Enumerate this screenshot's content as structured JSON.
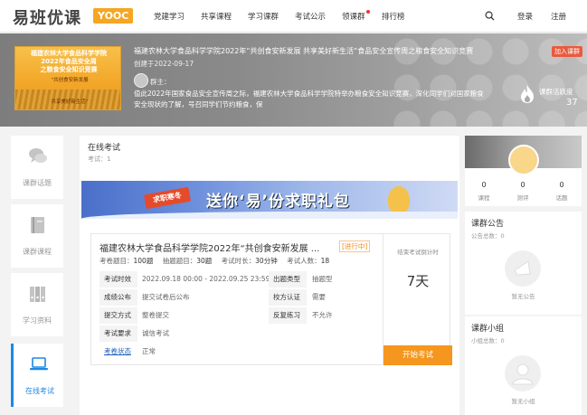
{
  "header": {
    "logo_text": "易班优课",
    "logo_badge": "YOOC",
    "nav": [
      "党建学习",
      "共享课程",
      "学习课群",
      "考试公示",
      "领课群",
      "排行榜"
    ],
    "login": "登录",
    "register": "注册"
  },
  "hero": {
    "cover_line1": "福建农林大学食品科学学院",
    "cover_line2": "2022年食品安全周",
    "cover_line3": "之粮食安全知识竞赛",
    "cover_slogan1": "“共创食安新发展",
    "cover_slogan2": "共享美好新生活”",
    "title": "福建农林大学食品科学学院2022年“共创食安新发展 共享美好新生活”食品安全宣传周之粮食安全知识竞赛",
    "created": "创建于2022-09-17",
    "owner_label": "群主：",
    "desc": "值此2022年国家食品安全宣传周之际，福建农林大学食品科学学院特举办粮食安全知识竞赛，深化同学们对国家粮食安全现状的了解，号召同学们节约粮食，保",
    "join_button": "加入课群",
    "activity_label": "课群活跃度",
    "activity_value": "37"
  },
  "sidebar": [
    {
      "label": "课群话题"
    },
    {
      "label": "课群课程"
    },
    {
      "label": "学习资料"
    },
    {
      "label": "在线考试"
    }
  ],
  "main": {
    "title": "在线考试",
    "count": "考试：1",
    "banner_sign": "求职寒冬",
    "banner_text": "送你‘易’份求职礼包",
    "exam": {
      "title": "福建农林大学食品科学学院2022年“共创食安新发展 ...",
      "status": "[进行中]",
      "stats": [
        {
          "k": "考卷题目：",
          "v": "100题"
        },
        {
          "k": "抽题题目：",
          "v": "30题"
        },
        {
          "k": "考试时长：",
          "v": "30分钟"
        },
        {
          "k": "考试人数：",
          "v": "18"
        }
      ],
      "rows": [
        {
          "k1": "考试时效",
          "v1": "2022.09.18 00:00 - 2022.09.25 23:59",
          "k2": "出题类型",
          "v2": "抽题型"
        },
        {
          "k1": "成绩公布",
          "v1": "提交试卷后公布",
          "k2": "校方认证",
          "v2": "需要"
        },
        {
          "k1": "提交方式",
          "v1": "整卷提交",
          "k2": "反复练习",
          "v2": "不允许"
        },
        {
          "k1": "考试要求",
          "v1": "诚信考试",
          "k2": "",
          "v2": ""
        }
      ],
      "last_row": {
        "k": "考卷状态",
        "v": "正常"
      },
      "countdown_label": "结束考试倒计时",
      "countdown_value": "7天",
      "start_button": "开始考试"
    }
  },
  "right": {
    "stats": [
      {
        "v": "0",
        "l": "课程"
      },
      {
        "v": "0",
        "l": "测评"
      },
      {
        "v": "0",
        "l": "话题"
      }
    ],
    "notice_title": "课群公告",
    "notice_count": "公告总数：0",
    "notice_empty": "暂无公告",
    "group_title": "课群小组",
    "group_count": "小组总数：0",
    "group_empty": "暂无小组"
  },
  "colors": {
    "accent_blue": "#1e88e5",
    "start_orange": "#f5961e",
    "status_orange": "#f08c1c",
    "logo_badge": "#f5a623"
  }
}
